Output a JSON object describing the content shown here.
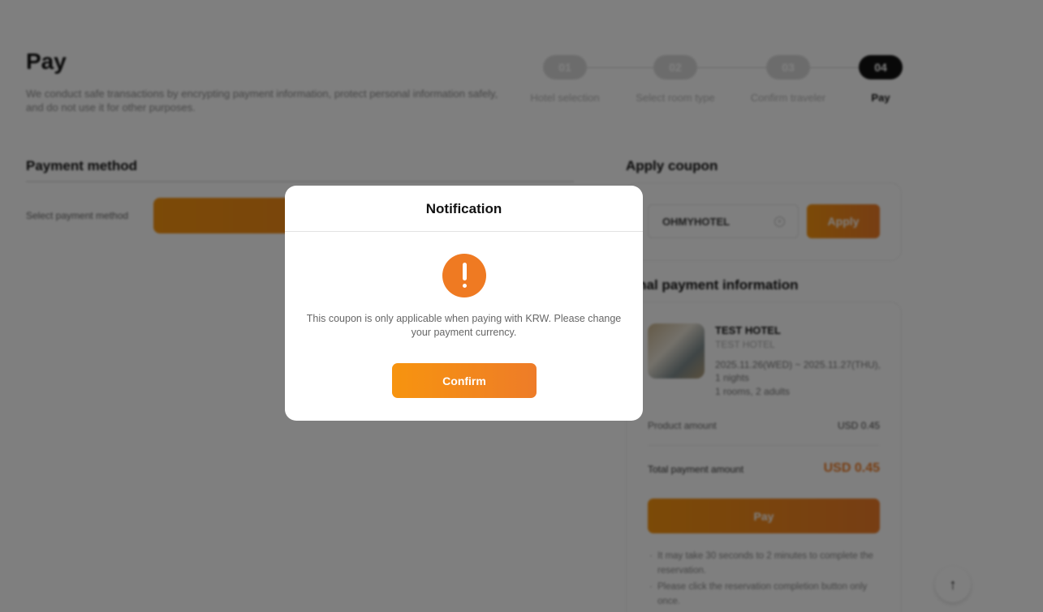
{
  "page": {
    "title": "Pay",
    "description": "We conduct safe transactions by encrypting payment information, protect personal information safely, and do not use it for other purposes."
  },
  "steps": [
    {
      "num": "01",
      "label": "Hotel selection"
    },
    {
      "num": "02",
      "label": "Select room type"
    },
    {
      "num": "03",
      "label": "Confirm traveler"
    },
    {
      "num": "04",
      "label": "Pay",
      "active": true
    }
  ],
  "payment_method": {
    "title": "Payment method",
    "select_label": "Select payment method"
  },
  "coupon": {
    "title": "Apply coupon",
    "code": "OHMYHOTEL",
    "apply_label": "Apply"
  },
  "final_payment": {
    "title": "Final payment information",
    "hotel_name": "TEST HOTEL",
    "hotel_sub": "TEST HOTEL",
    "dates": "2025.11.26(WED) ~ 2025.11.27(THU), 1 nights",
    "rooms": "1 rooms, 2 adults",
    "product_label": "Product amount",
    "product_value": "USD 0.45",
    "total_label": "Total payment amount",
    "total_value": "USD 0.45",
    "pay_label": "Pay",
    "notes": [
      "It may take 30 seconds to 2 minutes to complete the reservation.",
      "Please click the reservation completion button only once."
    ]
  },
  "modal": {
    "title": "Notification",
    "message": "This coupon is only applicable when paying with KRW. Please change your payment currency.",
    "confirm_label": "Confirm"
  },
  "colors": {
    "accent": "#ef7a22",
    "overlay": "rgba(0,0,0,0.5)"
  },
  "icons": {
    "alert": "exclamation-circle-icon",
    "scroll_top": "arrow-up-icon",
    "clear": "clear-icon"
  }
}
